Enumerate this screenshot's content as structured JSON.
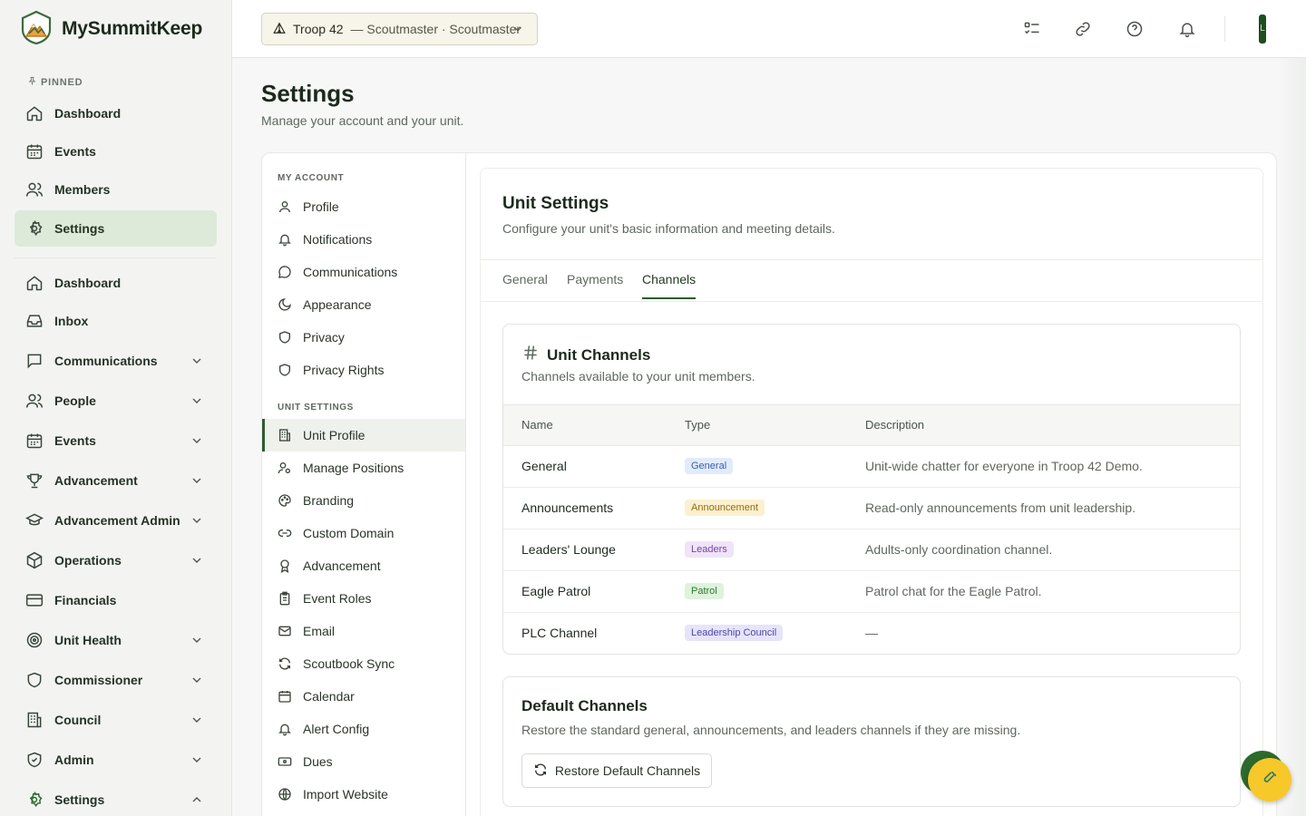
{
  "brand": {
    "name": "MySummitKeep"
  },
  "sidebar": {
    "pinned_label": "PINNED",
    "pinned": [
      {
        "label": "Dashboard",
        "icon": "home-icon"
      },
      {
        "label": "Events",
        "icon": "calendar-icon"
      },
      {
        "label": "Members",
        "icon": "users-icon"
      },
      {
        "label": "Settings",
        "icon": "gear-icon",
        "active": true
      }
    ],
    "items": [
      {
        "label": "Dashboard",
        "icon": "home-icon",
        "expand": "none"
      },
      {
        "label": "Inbox",
        "icon": "inbox-icon",
        "expand": "none"
      },
      {
        "label": "Communications",
        "icon": "message-icon",
        "expand": "down"
      },
      {
        "label": "People",
        "icon": "users-icon",
        "expand": "down"
      },
      {
        "label": "Events",
        "icon": "calendar-icon",
        "expand": "down"
      },
      {
        "label": "Advancement",
        "icon": "trophy-icon",
        "expand": "down"
      },
      {
        "label": "Advancement Admin",
        "icon": "graduation-cap-icon",
        "expand": "down"
      },
      {
        "label": "Operations",
        "icon": "box-icon",
        "expand": "down"
      },
      {
        "label": "Financials",
        "icon": "credit-card-icon",
        "expand": "none"
      },
      {
        "label": "Unit Health",
        "icon": "target-icon",
        "expand": "down"
      },
      {
        "label": "Commissioner",
        "icon": "shield-icon",
        "expand": "down"
      },
      {
        "label": "Council",
        "icon": "building-icon",
        "expand": "down"
      },
      {
        "label": "Admin",
        "icon": "shield-check-icon",
        "expand": "down"
      },
      {
        "label": "Settings",
        "icon": "gear-icon",
        "expand": "up"
      }
    ]
  },
  "topbar": {
    "unit_name": "Troop 42",
    "unit_role": "— Scoutmaster · Scoutmaster",
    "icons": [
      "checklist-icon",
      "link-icon",
      "help-icon",
      "bell-icon"
    ],
    "avatar_initial": "L"
  },
  "page": {
    "title": "Settings",
    "subtitle": "Manage your account and your unit."
  },
  "subnav": {
    "account_label": "MY ACCOUNT",
    "account_items": [
      {
        "label": "Profile",
        "icon": "user-icon"
      },
      {
        "label": "Notifications",
        "icon": "bell-icon"
      },
      {
        "label": "Communications",
        "icon": "chat-icon"
      },
      {
        "label": "Appearance",
        "icon": "moon-icon"
      },
      {
        "label": "Privacy",
        "icon": "shield-icon"
      },
      {
        "label": "Privacy Rights",
        "icon": "shield-icon"
      }
    ],
    "unit_label": "UNIT SETTINGS",
    "unit_items": [
      {
        "label": "Unit Profile",
        "icon": "building-icon",
        "active": true
      },
      {
        "label": "Manage Positions",
        "icon": "user-gear-icon"
      },
      {
        "label": "Branding",
        "icon": "palette-icon"
      },
      {
        "label": "Custom Domain",
        "icon": "link-icon"
      },
      {
        "label": "Advancement",
        "icon": "award-icon"
      },
      {
        "label": "Event Roles",
        "icon": "clipboard-icon"
      },
      {
        "label": "Email",
        "icon": "mail-icon"
      },
      {
        "label": "Scoutbook Sync",
        "icon": "refresh-icon"
      },
      {
        "label": "Calendar",
        "icon": "calendar-icon"
      },
      {
        "label": "Alert Config",
        "icon": "bell-icon"
      },
      {
        "label": "Dues",
        "icon": "banknote-icon"
      },
      {
        "label": "Import Website",
        "icon": "globe-icon"
      }
    ]
  },
  "unit_settings": {
    "title": "Unit Settings",
    "subtitle": "Configure your unit's basic information and meeting details.",
    "tabs": [
      {
        "label": "General",
        "active": false
      },
      {
        "label": "Payments",
        "active": false
      },
      {
        "label": "Channels",
        "active": true
      }
    ]
  },
  "channels_card": {
    "title": "Unit Channels",
    "subtitle": "Channels available to your unit members.",
    "columns": [
      "Name",
      "Type",
      "Description"
    ],
    "rows": [
      {
        "name": "General",
        "type": "General",
        "description": "Unit-wide chatter for everyone in Troop 42 Demo.",
        "badge_bg": "#e1ebfb",
        "badge_fg": "#3a5fa8"
      },
      {
        "name": "Announcements",
        "type": "Announcement",
        "description": "Read-only announcements from unit leadership.",
        "badge_bg": "#fbf0cf",
        "badge_fg": "#9a6a12"
      },
      {
        "name": "Leaders' Lounge",
        "type": "Leaders",
        "description": "Adults-only coordination channel.",
        "badge_bg": "#efe4f8",
        "badge_fg": "#7a3fa6"
      },
      {
        "name": "Eagle Patrol",
        "type": "Patrol",
        "description": "Patrol chat for the Eagle Patrol.",
        "badge_bg": "#def2dc",
        "badge_fg": "#2f7a2f"
      },
      {
        "name": "PLC Channel",
        "type": "Leadership Council",
        "description": "—",
        "badge_bg": "#e6e4fa",
        "badge_fg": "#4e45a8"
      }
    ]
  },
  "default_channels_card": {
    "title": "Default Channels",
    "subtitle": "Restore the standard general, announcements, and leaders channels if they are missing.",
    "button_label": "Restore Default Channels"
  }
}
